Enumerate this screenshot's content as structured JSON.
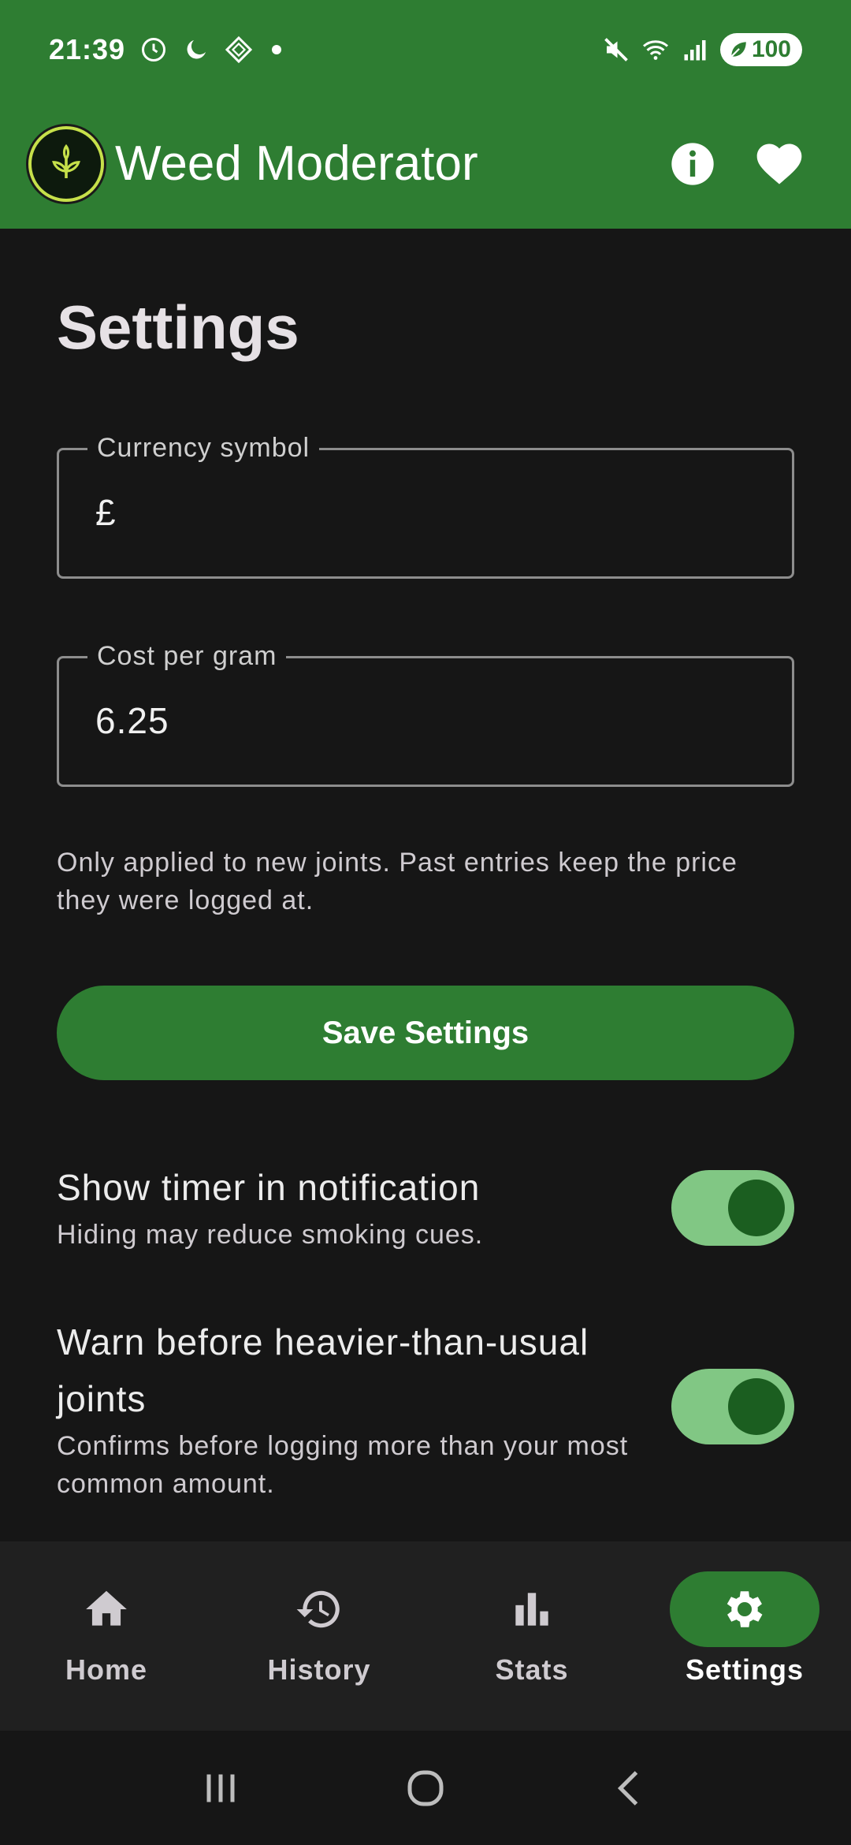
{
  "status_bar": {
    "time": "21:39",
    "battery": "100",
    "icons": [
      "alarm-icon",
      "moon-icon",
      "app-icon",
      "notification-dot",
      "mute-icon",
      "wifi-icon",
      "signal-icon",
      "battery-icon"
    ]
  },
  "app_bar": {
    "title": "Weed Moderator",
    "actions": [
      "info-icon",
      "heart-icon"
    ]
  },
  "settings": {
    "title": "Settings",
    "currency": {
      "label": "Currency symbol",
      "value": "£"
    },
    "cost": {
      "label": "Cost per gram",
      "value": "6.25"
    },
    "helper": "Only applied to new joints. Past entries keep the price they were logged at.",
    "save_label": "Save Settings",
    "toggles": [
      {
        "title": "Show timer in notification",
        "subtitle": "Hiding may reduce smoking cues.",
        "on": true
      },
      {
        "title": "Warn before heavier-than-usual joints",
        "subtitle": "Confirms before logging more than your most common amount.",
        "on": true
      }
    ]
  },
  "nav": {
    "items": [
      {
        "label": "Home",
        "icon": "home-icon"
      },
      {
        "label": "History",
        "icon": "history-icon"
      },
      {
        "label": "Stats",
        "icon": "bar-chart-icon"
      },
      {
        "label": "Settings",
        "icon": "gear-icon",
        "active": true
      }
    ]
  },
  "colors": {
    "primary": "#2e7d32",
    "background": "#161616",
    "toggle_track": "#81c784",
    "toggle_knob": "#1b5e20"
  }
}
